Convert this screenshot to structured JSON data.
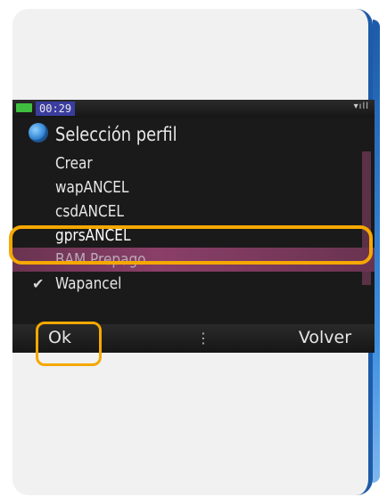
{
  "status_bar": {
    "time": "00:29",
    "signal_icon": "signal-icon",
    "battery_icon": "battery-icon"
  },
  "header": {
    "icon": "globe-icon",
    "title": "Selección perfil"
  },
  "list": {
    "items": [
      {
        "label": "Crear"
      },
      {
        "label": "wapANCEL"
      },
      {
        "label": "csdANCEL"
      },
      {
        "label": "gprsANCEL"
      },
      {
        "label": "BAM Prepago"
      },
      {
        "label": "Wapancel",
        "checked": true
      }
    ]
  },
  "softkeys": {
    "left": "Ok",
    "middle": "⋮",
    "right": "Volver"
  },
  "colors": {
    "highlight": "#f5a800",
    "selection": "#8a3f68",
    "screen_bg": "#1a1a1a",
    "card_edge": "#1d5ba8"
  }
}
